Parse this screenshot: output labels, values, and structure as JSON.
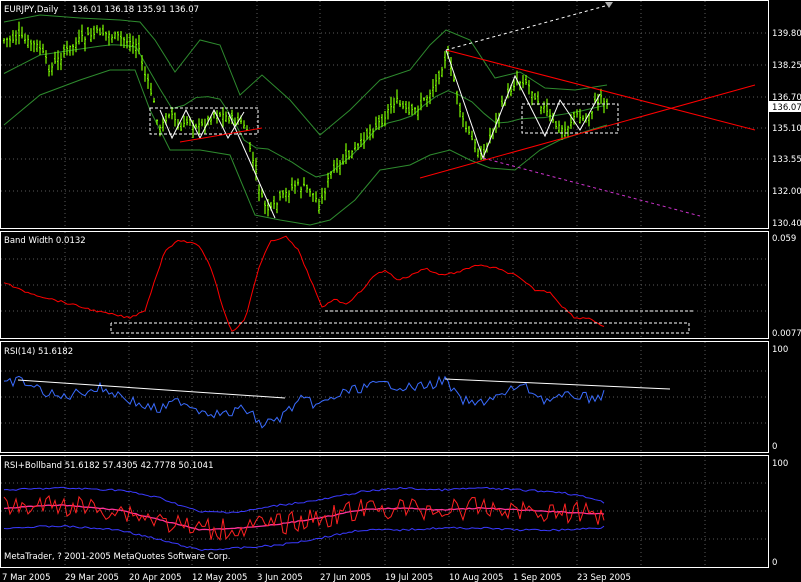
{
  "main_panel": {
    "title": "EURJPY,Daily",
    "ohlc": "136.01 136.18 135.91 136.07",
    "price_ticks": [
      "139.80",
      "138.25",
      "136.70",
      "135.10",
      "133.55",
      "132.00",
      "130.40"
    ],
    "current_price": "136.07"
  },
  "bandwidth_panel": {
    "title": "Band Width 0.0132",
    "ticks": [
      "0.059",
      "0.0077"
    ]
  },
  "rsi_panel": {
    "title": "RSI(14) 51.6182",
    "ticks": [
      "100",
      "0"
    ]
  },
  "rsi_bb_panel": {
    "title": "RSI+Bollband 51.6182 57.4305 42.7778 50.1041",
    "ticks": [
      "100",
      "0"
    ]
  },
  "copyright": "MetaTrader, ? 2001-2005 MetaQuotes Software Corp.",
  "date_axis": [
    "7 Mar 2005",
    "29 Mar 2005",
    "20 Apr 2005",
    "12 May 2005",
    "3 Jun 2005",
    "27 Jun 2005",
    "19 Jul 2005",
    "10 Aug 2005",
    "1 Sep 2005",
    "23 Sep 2005"
  ],
  "colors": {
    "background": "#000000",
    "grid": "#5a5a5a",
    "candles": "#7cfc00",
    "bollinger": "#2e8b2e",
    "trendline": "#ff0000",
    "bandwidth": "#ff0000",
    "rsi": "#3a6cff",
    "rsi_bb_line": "#ff3399",
    "price_marker": "#ffffff"
  }
}
